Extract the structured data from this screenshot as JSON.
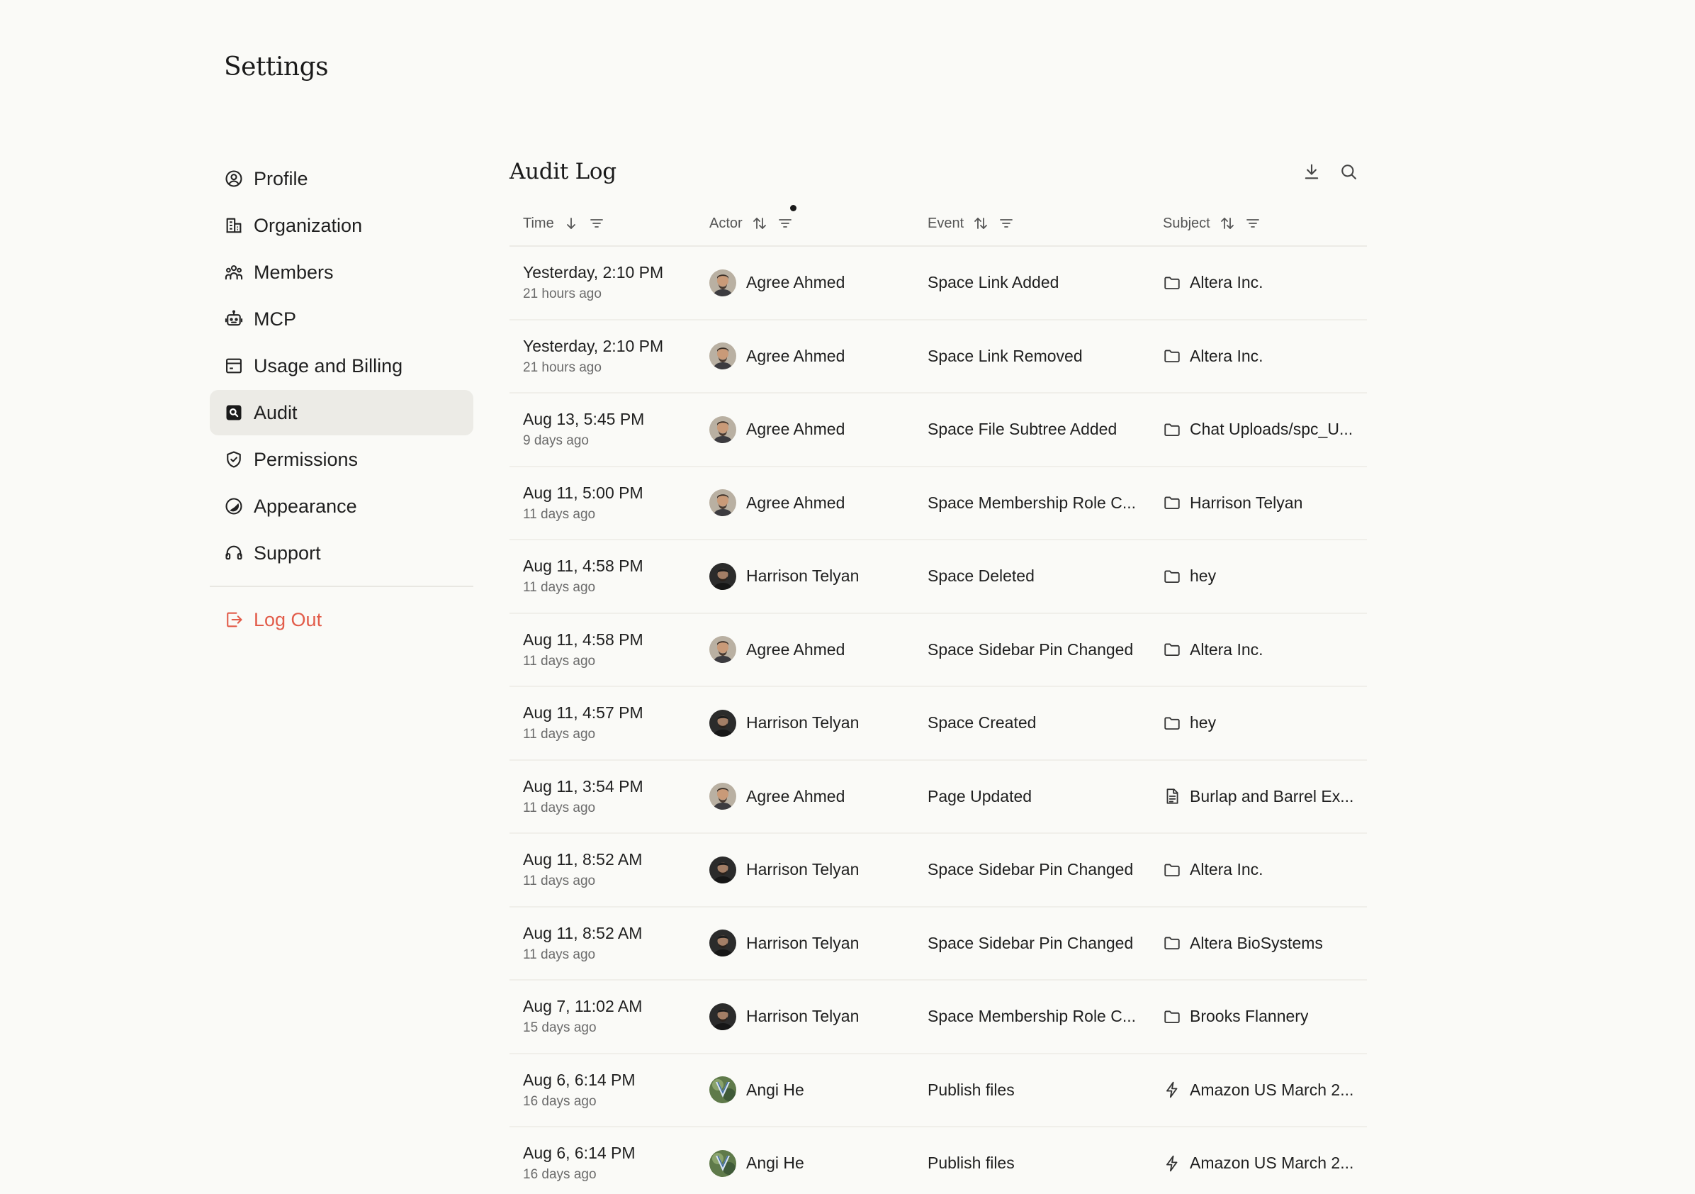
{
  "page_title": "Settings",
  "sidebar": {
    "items": [
      {
        "label": "Profile",
        "icon": "profile-icon"
      },
      {
        "label": "Organization",
        "icon": "organization-icon"
      },
      {
        "label": "Members",
        "icon": "members-icon"
      },
      {
        "label": "MCP",
        "icon": "robot-icon"
      },
      {
        "label": "Usage and Billing",
        "icon": "billing-icon"
      },
      {
        "label": "Audit",
        "icon": "audit-icon",
        "active": true
      },
      {
        "label": "Permissions",
        "icon": "shield-icon"
      },
      {
        "label": "Appearance",
        "icon": "appearance-icon"
      },
      {
        "label": "Support",
        "icon": "headset-icon"
      }
    ],
    "logout_label": "Log Out"
  },
  "colors": {
    "background": "#fafaf7",
    "active_item": "#ecebe6",
    "logout": "#e25c4a",
    "text": "#1f1f1f",
    "muted": "#6b6b6b"
  },
  "main": {
    "title": "Audit Log",
    "header_icons": [
      "download-icon",
      "search-icon"
    ],
    "columns": {
      "time": "Time",
      "actor": "Actor",
      "event": "Event",
      "subject": "Subject"
    },
    "rows": [
      {
        "time": "Yesterday, 2:10 PM",
        "relative": "21 hours ago",
        "actor": "Agree Ahmed",
        "event": "Space Link Added",
        "subject": "Altera Inc.",
        "subject_icon": "folder-icon"
      },
      {
        "time": "Yesterday, 2:10 PM",
        "relative": "21 hours ago",
        "actor": "Agree Ahmed",
        "event": "Space Link Removed",
        "subject": "Altera Inc.",
        "subject_icon": "folder-icon"
      },
      {
        "time": "Aug 13, 5:45 PM",
        "relative": "9 days ago",
        "actor": "Agree Ahmed",
        "event": "Space File Subtree Added",
        "subject": "Chat Uploads/spc_U...",
        "subject_icon": "folder-icon"
      },
      {
        "time": "Aug 11, 5:00 PM",
        "relative": "11 days ago",
        "actor": "Agree Ahmed",
        "event": "Space Membership Role C...",
        "subject": "Harrison Telyan",
        "subject_icon": "folder-icon"
      },
      {
        "time": "Aug 11, 4:58 PM",
        "relative": "11 days ago",
        "actor": "Harrison Telyan",
        "event": "Space Deleted",
        "subject": "hey",
        "subject_icon": "folder-icon"
      },
      {
        "time": "Aug 11, 4:58 PM",
        "relative": "11 days ago",
        "actor": "Agree Ahmed",
        "event": "Space Sidebar Pin Changed",
        "subject": "Altera Inc.",
        "subject_icon": "folder-icon"
      },
      {
        "time": "Aug 11, 4:57 PM",
        "relative": "11 days ago",
        "actor": "Harrison Telyan",
        "event": "Space Created",
        "subject": "hey",
        "subject_icon": "folder-icon"
      },
      {
        "time": "Aug 11, 3:54 PM",
        "relative": "11 days ago",
        "actor": "Agree Ahmed",
        "event": "Page Updated",
        "subject": "Burlap and Barrel Ex...",
        "subject_icon": "document-icon"
      },
      {
        "time": "Aug 11, 8:52 AM",
        "relative": "11 days ago",
        "actor": "Harrison Telyan",
        "event": "Space Sidebar Pin Changed",
        "subject": "Altera Inc.",
        "subject_icon": "folder-icon"
      },
      {
        "time": "Aug 11, 8:52 AM",
        "relative": "11 days ago",
        "actor": "Harrison Telyan",
        "event": "Space Sidebar Pin Changed",
        "subject": "Altera BioSystems",
        "subject_icon": "folder-icon"
      },
      {
        "time": "Aug 7, 11:02 AM",
        "relative": "15 days ago",
        "actor": "Harrison Telyan",
        "event": "Space Membership Role C...",
        "subject": "Brooks Flannery",
        "subject_icon": "folder-icon"
      },
      {
        "time": "Aug 6, 6:14 PM",
        "relative": "16 days ago",
        "actor": "Angi He",
        "event": "Publish files",
        "subject": "Amazon US March 2...",
        "subject_icon": "lightning-icon"
      },
      {
        "time": "Aug 6, 6:14 PM",
        "relative": "16 days ago",
        "actor": "Angi He",
        "event": "Publish files",
        "subject": "Amazon US March 2...",
        "subject_icon": "lightning-icon"
      }
    ]
  }
}
